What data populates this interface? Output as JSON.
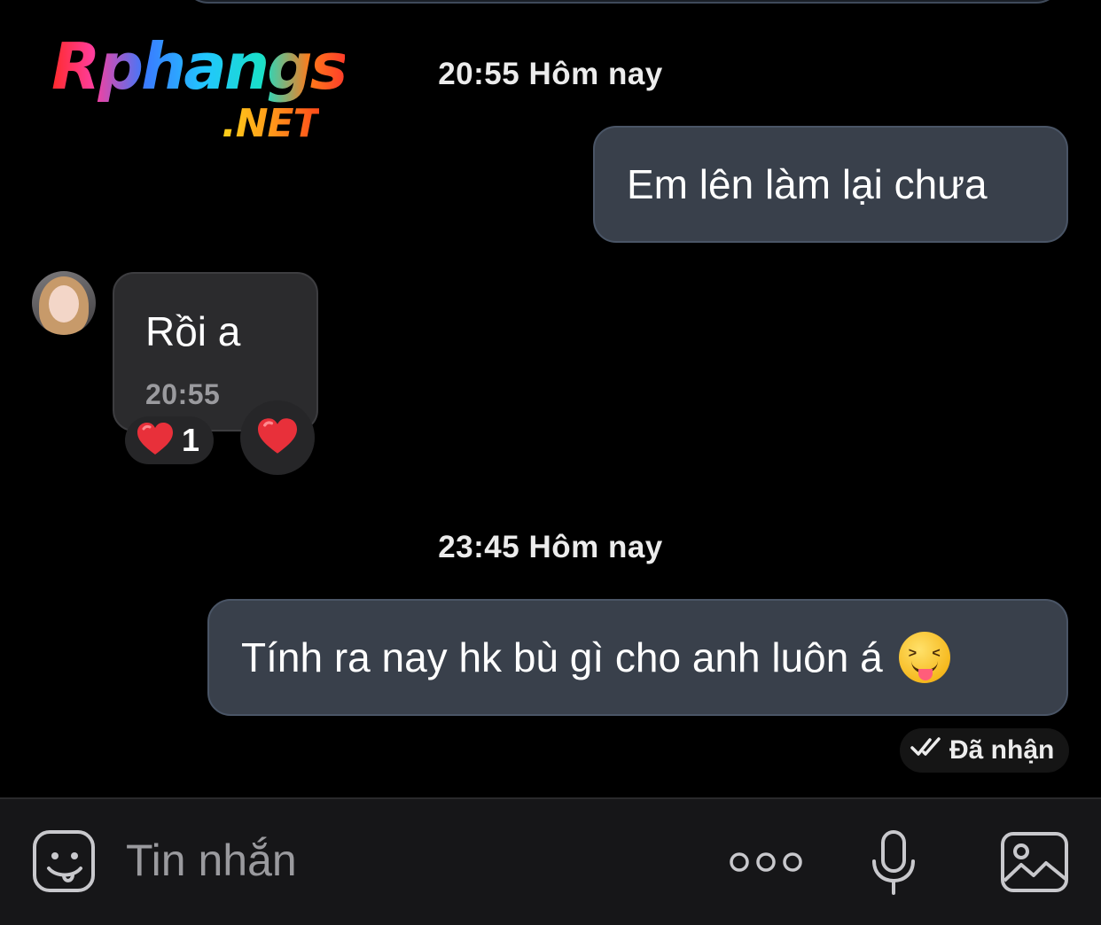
{
  "watermark": {
    "brand": "Rphangs",
    "tld": ".NET"
  },
  "conversation": {
    "timestamp_1": "20:55 Hôm nay",
    "outgoing_1": "Em lên làm lại chưa",
    "incoming": {
      "text": "Rồi a",
      "time": "20:55",
      "reaction_count": "1"
    },
    "timestamp_2": "23:45 Hôm nay",
    "outgoing_2": "Tính ra nay hk bù gì cho anh luôn á",
    "receipt_status": "Đã nhận"
  },
  "composer": {
    "placeholder": "Tin nhắn"
  },
  "icons": [
    "emoji-sticker-icon",
    "more-dots-icon",
    "microphone-icon",
    "image-icon",
    "heart-icon",
    "double-check-icon",
    "squinting-tongue-emoji"
  ],
  "colors": {
    "background": "#000000",
    "outgoing_bubble": "#39404b",
    "incoming_bubble": "#2b2b2d",
    "composer_bg": "#161618",
    "heart": "#e8303a"
  }
}
